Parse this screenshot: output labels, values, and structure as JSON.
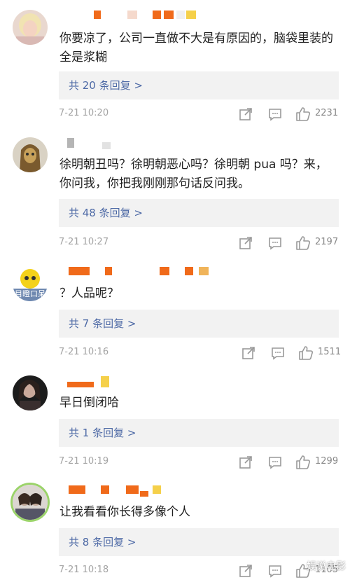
{
  "comments": [
    {
      "text": "你要凉了，公司一直做不大是有原因的，脑袋里装的全是浆糊",
      "reply_label": "共 20 条回复 >",
      "time": "7-21 10:20",
      "likes": "2231",
      "avatar_icon": "avatar-photo-blonde"
    },
    {
      "text": "徐明朝丑吗？徐明朝恶心吗？徐明朝 pua 吗？来，你问我，你把我刚刚那句话反问我。",
      "reply_label": "共 48 条回复 >",
      "time": "7-21 10:27",
      "likes": "2197",
      "avatar_icon": "avatar-mask"
    },
    {
      "text": "？人品呢？",
      "reply_label": "共 7 条回复 >",
      "time": "7-21 10:16",
      "likes": "1511",
      "avatar_icon": "avatar-cartoon",
      "avatar_caption": "目瞪口呆"
    },
    {
      "text": "早日倒闭哈",
      "reply_label": "共 1 条回复 >",
      "time": "7-21 10:19",
      "likes": "1299",
      "avatar_icon": "avatar-photo-dark"
    },
    {
      "text": "让我看看你长得多像个人",
      "reply_label": "共 8 条回复 >",
      "time": "7-21 10:18",
      "likes": "1105",
      "avatar_icon": "avatar-photo-group"
    }
  ],
  "watermark": "娱说电影",
  "colors": {
    "reply_link": "#4e6aa6",
    "reply_bg": "#f2f2f2",
    "meta_text": "#a3a3a3",
    "redaction_orange": "#f06a1a",
    "redaction_yellow": "#f5d04a"
  }
}
